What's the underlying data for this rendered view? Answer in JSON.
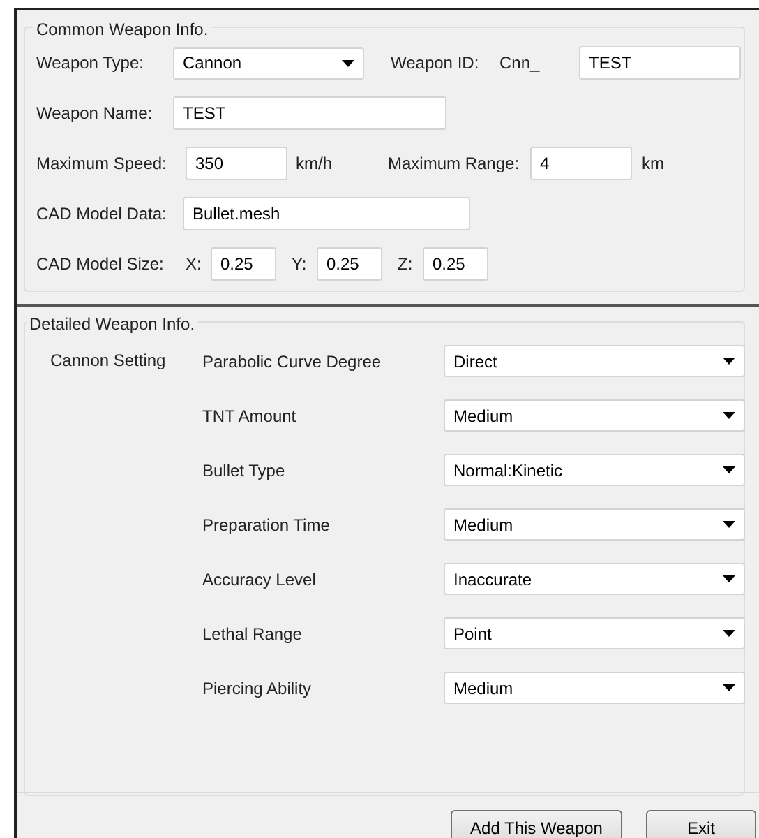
{
  "common": {
    "title": "Common Weapon Info.",
    "weapon_type": {
      "label": "Weapon Type:",
      "value": "Cannon"
    },
    "weapon_id": {
      "label": "Weapon ID:",
      "prefix": "Cnn_",
      "value": "TEST"
    },
    "weapon_name": {
      "label": "Weapon Name:",
      "value": "TEST"
    },
    "max_speed": {
      "label": "Maximum Speed:",
      "value": "350",
      "unit": "km/h"
    },
    "max_range": {
      "label": "Maximum Range:",
      "value": "4",
      "unit": "km"
    },
    "cad_data": {
      "label": "CAD Model Data:",
      "value": "Bullet.mesh"
    },
    "cad_size": {
      "label": "CAD Model Size:",
      "axes": [
        {
          "label": "X:",
          "value": "0.25"
        },
        {
          "label": "Y:",
          "value": "0.25"
        },
        {
          "label": "Z:",
          "value": "0.25"
        }
      ]
    }
  },
  "detailed": {
    "title": "Detailed Weapon Info.",
    "group_label": "Cannon Setting",
    "settings": [
      {
        "label": "Parabolic Curve Degree",
        "value": "Direct"
      },
      {
        "label": "TNT Amount",
        "value": "Medium"
      },
      {
        "label": "Bullet Type",
        "value": "Normal:Kinetic"
      },
      {
        "label": "Preparation Time",
        "value": "Medium"
      },
      {
        "label": "Accuracy Level",
        "value": "Inaccurate"
      },
      {
        "label": "Lethal Range",
        "value": "Point"
      },
      {
        "label": "Piercing Ability",
        "value": "Medium"
      }
    ]
  },
  "buttons": [
    "Add This Weapon",
    "Exit"
  ]
}
